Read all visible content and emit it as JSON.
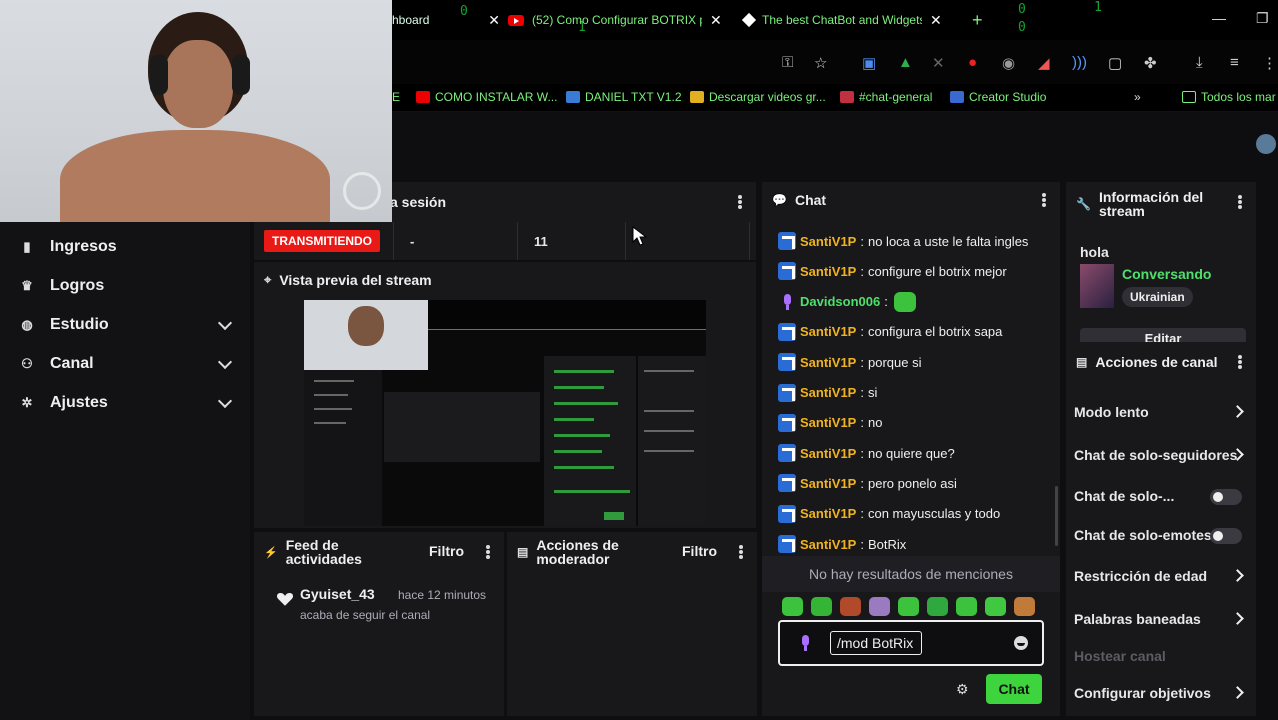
{
  "browser": {
    "tabs": [
      {
        "label": "hboard",
        "active": false
      },
      {
        "label": "(52) Como Configurar BOTRIX p",
        "active": false
      },
      {
        "label": "The best ChatBot and Widgets",
        "active": true
      }
    ],
    "bookmarks": [
      {
        "label": "E",
        "icon": "red"
      },
      {
        "label": "COMO INSTALAR W...",
        "icon": "youtube-icon"
      },
      {
        "label": "DANIEL TXT V1.2",
        "icon": "blue"
      },
      {
        "label": "Descargar videos gr...",
        "icon": "yellow"
      },
      {
        "label": "#chat-general",
        "icon": "discord"
      },
      {
        "label": "Creator Studio",
        "icon": "blue2"
      },
      {
        "label": "Todos los mar",
        "icon": "folder-icon"
      }
    ],
    "bookmarks_more": "»"
  },
  "sidebar": {
    "items": [
      {
        "label": "Ingresos",
        "icon": "bar-chart-icon",
        "expandable": false
      },
      {
        "label": "Logros",
        "icon": "trophy-icon",
        "expandable": false
      },
      {
        "label": "Estudio",
        "icon": "studio-icon",
        "expandable": true
      },
      {
        "label": "Canal",
        "icon": "people-icon",
        "expandable": true
      },
      {
        "label": "Ajustes",
        "icon": "gear-icon",
        "expandable": true
      }
    ]
  },
  "session": {
    "title": "a sesión",
    "live_badge": "TRANSMITIENDO",
    "stat_2": "-",
    "stat_3": "11"
  },
  "preview": {
    "title": "Vista previa del stream"
  },
  "feed": {
    "title": "Feed de actividades",
    "filter": "Filtro",
    "item": {
      "user": "Gyuiset_43",
      "time": "hace 12 minutos",
      "desc": "acaba de seguir el canal"
    }
  },
  "modactions": {
    "title": "Acciones de moderador",
    "filter": "Filtro"
  },
  "chat": {
    "title": "Chat",
    "messages": [
      {
        "user": "SantiV1P",
        "text": "no loca a uste le falta ingles",
        "badge": "bot"
      },
      {
        "user": "SantiV1P",
        "text": "configure el botrix mejor",
        "badge": "bot"
      },
      {
        "user": "Davidson006",
        "text": "",
        "badge": "mic",
        "emote": true
      },
      {
        "user": "SantiV1P",
        "text": "configura el botrix sapa",
        "badge": "bot"
      },
      {
        "user": "SantiV1P",
        "text": "porque si",
        "badge": "bot"
      },
      {
        "user": "SantiV1P",
        "text": "si",
        "badge": "bot"
      },
      {
        "user": "SantiV1P",
        "text": "no",
        "badge": "bot"
      },
      {
        "user": "SantiV1P",
        "text": "no quiere que?",
        "badge": "bot"
      },
      {
        "user": "SantiV1P",
        "text": "pero ponelo asi",
        "badge": "bot"
      },
      {
        "user": "SantiV1P",
        "text": "con mayusculas y todo",
        "badge": "bot"
      },
      {
        "user": "SantiV1P",
        "text": "BotRix",
        "badge": "bot"
      }
    ],
    "mentions": "No hay resultados de menciones",
    "input_value": "/mod BotRix",
    "send_label": "Chat"
  },
  "info": {
    "title": "Información del stream",
    "stream_title": "hola",
    "category": "Conversando",
    "tag": "Ukrainian",
    "edit_label": "Editar"
  },
  "actions": {
    "title": "Acciones de canal",
    "items": [
      {
        "label": "Modo lento",
        "control": "chevron"
      },
      {
        "label": "Chat de solo-seguidores",
        "control": "chevron"
      },
      {
        "label": "Chat de solo-...",
        "control": "toggle"
      },
      {
        "label": "Chat de solo-emotes",
        "control": "toggle"
      },
      {
        "label": "Restricción de edad",
        "control": "chevron"
      },
      {
        "label": "Palabras baneadas",
        "control": "chevron"
      },
      {
        "label": "Hostear canal",
        "control": "none",
        "disabled": true
      },
      {
        "label": "Configurar objetivos",
        "control": "chevron"
      }
    ]
  },
  "colors": {
    "accent": "#3dd43d",
    "live": "#e91916",
    "username": "#f0b321",
    "bot_badge": "#2a6cd6"
  }
}
